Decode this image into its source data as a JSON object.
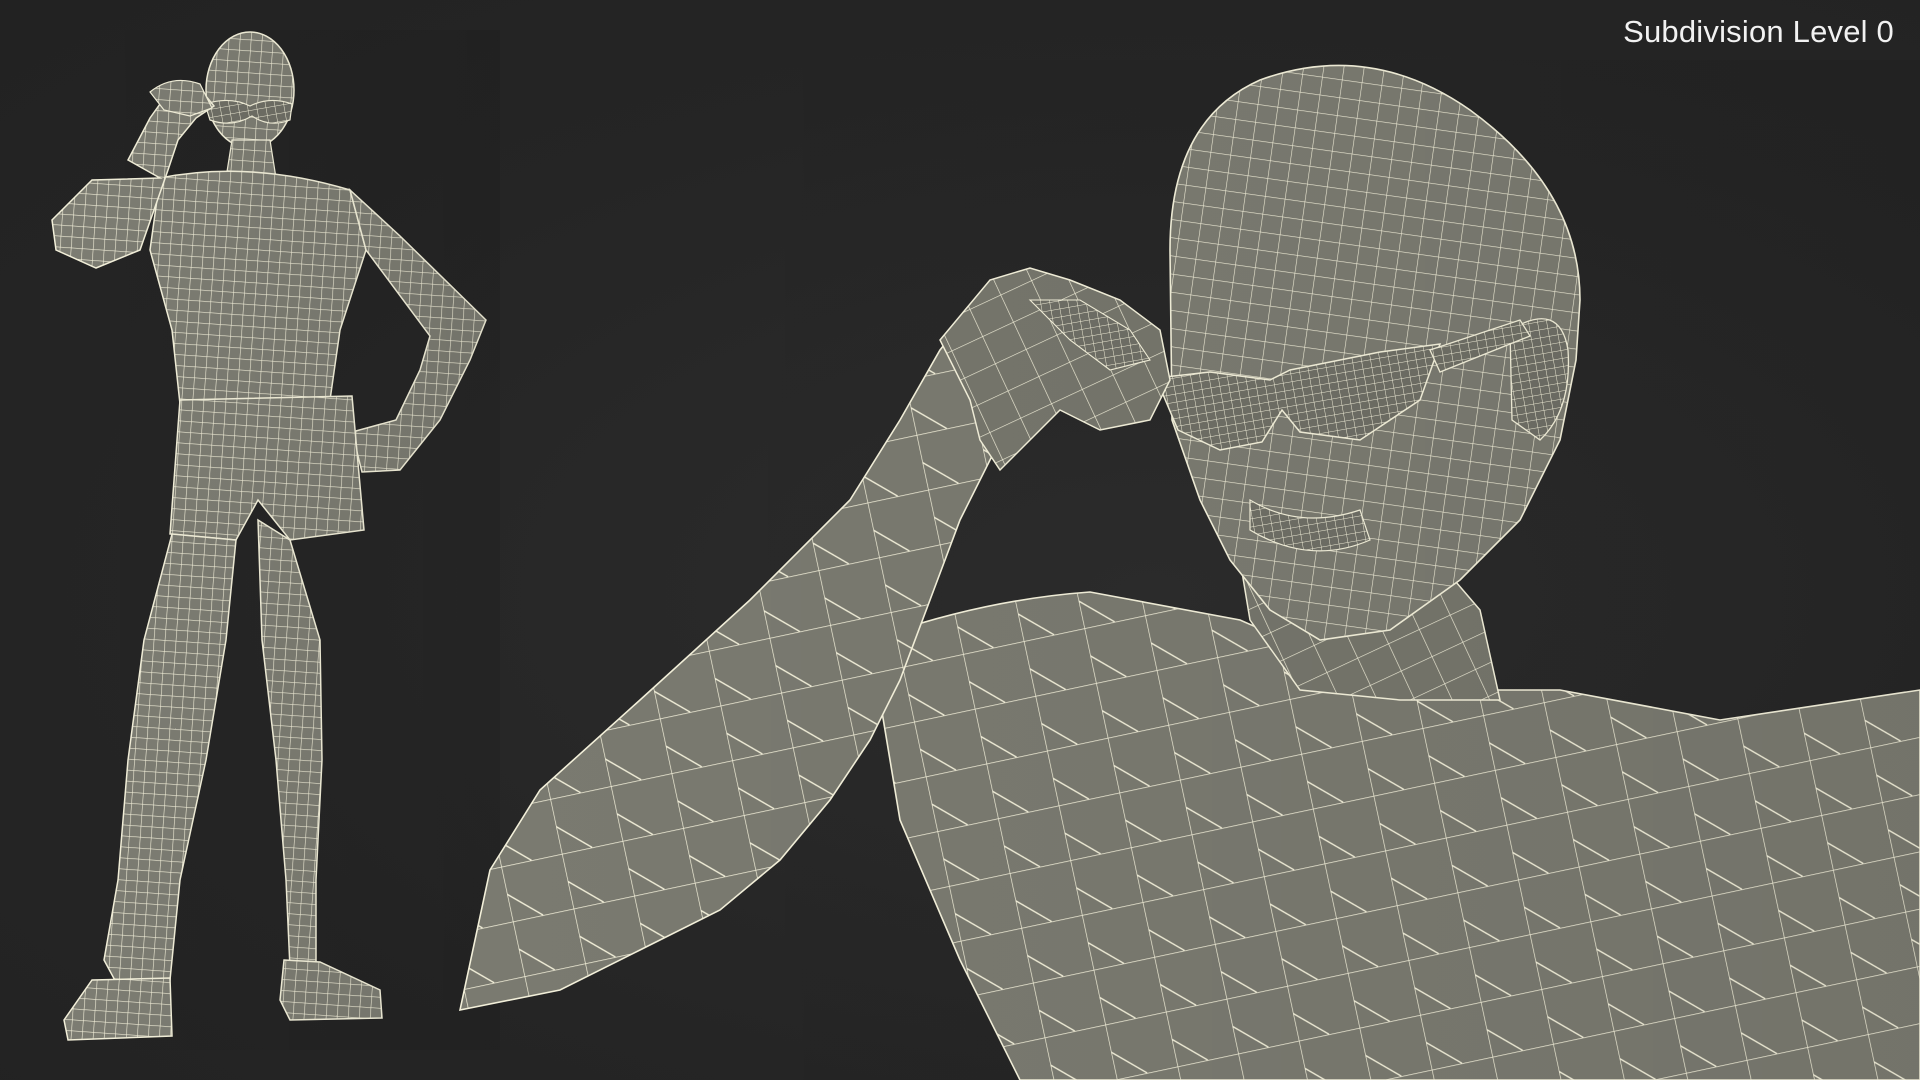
{
  "viewport": {
    "subdivision_label": "Subdivision Level 0"
  },
  "render": {
    "background_color": "#262626",
    "mesh_fill_color": "#7c7c72",
    "wire_color": "#f4f1dc",
    "subject": "wireframe-male-figure-with-sunglasses"
  }
}
